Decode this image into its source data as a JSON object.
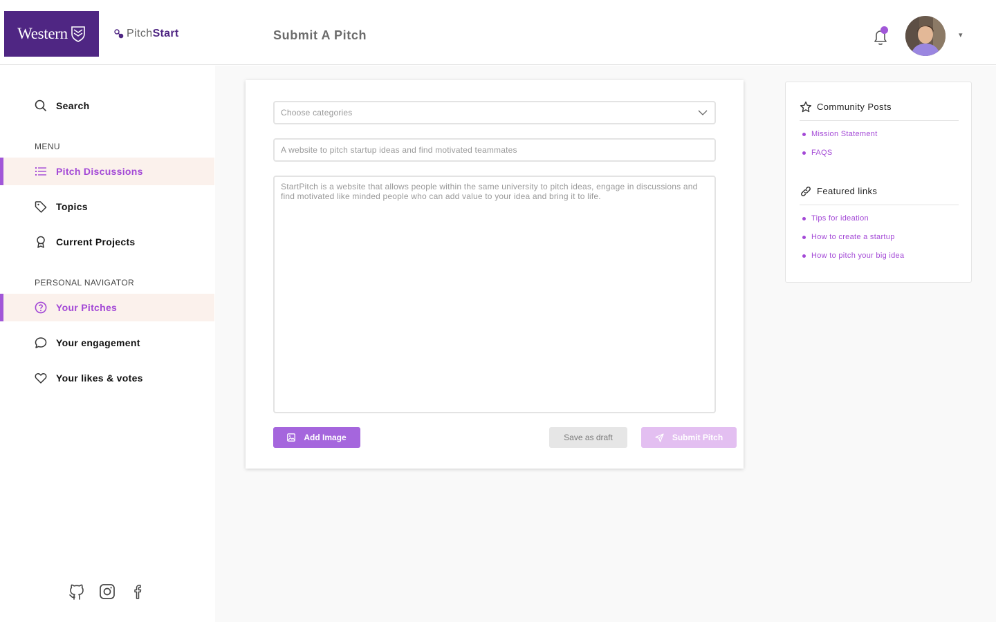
{
  "brand": {
    "logo_text": "Western",
    "product_prefix": "Pitch",
    "product_suffix": "Start"
  },
  "header": {
    "page_title": "Submit A Pitch",
    "user_menu_caret": "▾"
  },
  "sidebar": {
    "search_label": "Search",
    "menu_heading": "MENU",
    "menu_items": [
      {
        "label": "Pitch Discussions",
        "icon": "list-icon",
        "active": true
      },
      {
        "label": "Topics",
        "icon": "tag-icon",
        "active": false
      },
      {
        "label": "Current Projects",
        "icon": "award-icon",
        "active": false
      }
    ],
    "personal_heading": "PERSONAL NAVIGATOR",
    "personal_items": [
      {
        "label": "Your Pitches",
        "icon": "question-circle-icon",
        "active": true
      },
      {
        "label": "Your engagement",
        "icon": "chat-bubble-icon",
        "active": false
      },
      {
        "label": "Your likes & votes",
        "icon": "heart-icon",
        "active": false
      }
    ],
    "social_icons": [
      "github-icon",
      "instagram-icon",
      "facebook-icon"
    ]
  },
  "form": {
    "category_placeholder": "Choose categories",
    "title_value": "A website to pitch startup ideas and find motivated teammates",
    "description_value": "StartPitch is a website that allows people within the same university to pitch ideas, engage in discussions and find motivated like minded people who can add value to your idea and bring it to life.",
    "add_image_label": "Add Image",
    "save_draft_label": "Save as draft",
    "submit_label": "Submit Pitch"
  },
  "right_panel": {
    "community_title": "Community Posts",
    "community_links": [
      "Mission Statement",
      "FAQS"
    ],
    "featured_title": "Featured links",
    "featured_links": [
      "Tips for ideation",
      "How to create a startup",
      "How to pitch your big idea"
    ]
  },
  "colors": {
    "brand_purple": "#4f2683",
    "accent_purple": "#a348d6",
    "active_row_bg": "#fbf1ec",
    "submit_disabled": "#e3bff1"
  }
}
